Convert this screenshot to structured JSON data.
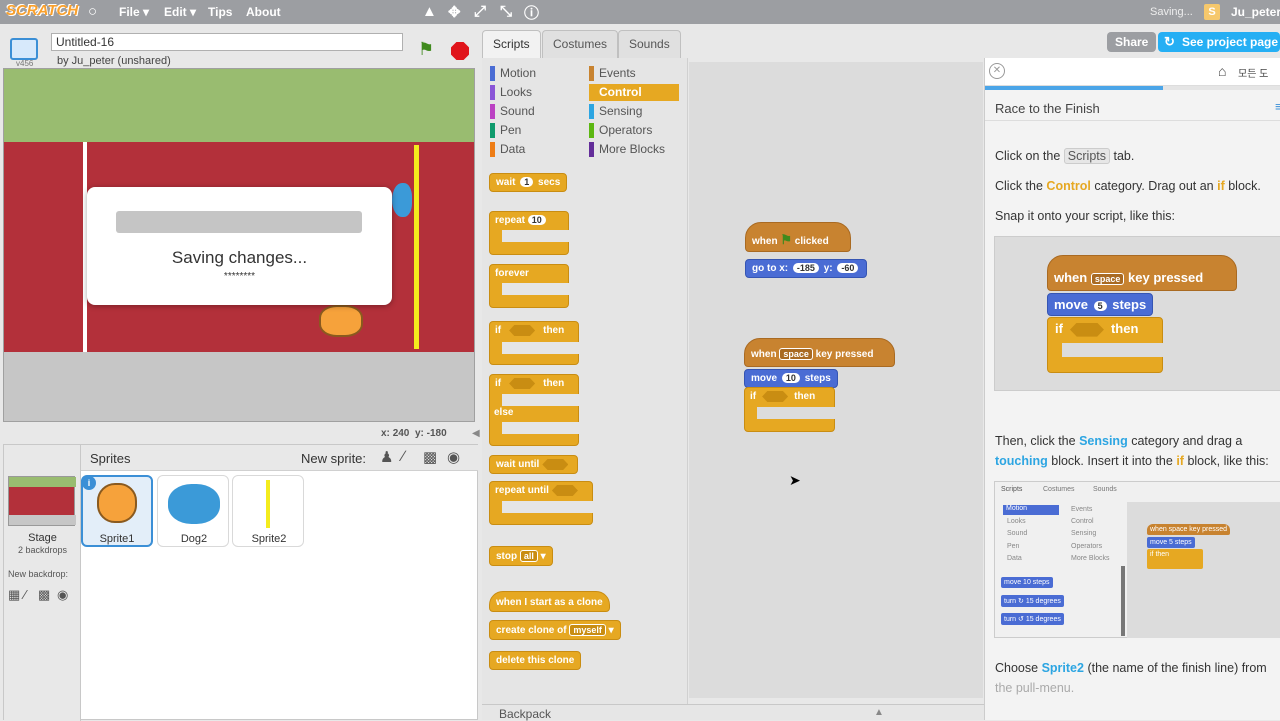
{
  "menubar": {
    "logo": "SCRATCH",
    "file": "File ▾",
    "edit": "Edit ▾",
    "tips": "Tips",
    "about": "About",
    "status": "Saving...",
    "username": "Ju_peter"
  },
  "project": {
    "title": "Untitled-16",
    "byline": "by Ju_peter (unshared)",
    "version": "v456"
  },
  "stage": {
    "dialog_text": "Saving changes...",
    "dialog_sub": "********",
    "x_label": "x:",
    "x_value": "240",
    "y_label": "y:",
    "y_value": "-180"
  },
  "sprites_pane": {
    "title": "Sprites",
    "new_sprite": "New sprite:",
    "stage_label": "Stage",
    "stage_backdrops": "2 backdrops",
    "new_backdrop": "New backdrop:",
    "sprites": [
      "Sprite1",
      "Dog2",
      "Sprite2"
    ]
  },
  "tabs": [
    "Scripts",
    "Costumes",
    "Sounds"
  ],
  "categories": {
    "left": [
      {
        "label": "Motion",
        "color": "#4a6cd4"
      },
      {
        "label": "Looks",
        "color": "#8a55d7"
      },
      {
        "label": "Sound",
        "color": "#bb42c3"
      },
      {
        "label": "Pen",
        "color": "#0e9a6c"
      },
      {
        "label": "Data",
        "color": "#ee7d16"
      }
    ],
    "right": [
      {
        "label": "Events",
        "color": "#c88330"
      },
      {
        "label": "Control",
        "color": "#e6a822"
      },
      {
        "label": "Sensing",
        "color": "#2ca5e2"
      },
      {
        "label": "Operators",
        "color": "#5cb712"
      },
      {
        "label": "More Blocks",
        "color": "#632d99"
      }
    ]
  },
  "palette_blocks": {
    "wait": "wait",
    "wait_val": "1",
    "wait_unit": "secs",
    "repeat": "repeat",
    "repeat_val": "10",
    "forever": "forever",
    "if": "if",
    "then": "then",
    "else": "else",
    "wait_until": "wait until",
    "repeat_until": "repeat until",
    "stop": "stop",
    "stop_val": "all",
    "clone_start": "when I start as a clone",
    "create_clone": "create clone of",
    "create_clone_val": "myself",
    "delete_clone": "delete this clone"
  },
  "script1": {
    "when": "when",
    "clicked": "clicked",
    "goto": "go to x:",
    "x": "-185",
    "y_label": "y:",
    "y": "-60"
  },
  "script2": {
    "when": "when",
    "key": "space",
    "pressed": "key pressed",
    "move": "move",
    "steps_val": "10",
    "steps": "steps",
    "if": "if",
    "then": "then"
  },
  "backpack": "Backpack",
  "header_right": {
    "share": "Share",
    "see_project": "See project page"
  },
  "tips_panel": {
    "home": "모든 도",
    "title": "Race to the Finish",
    "progress": 0.6,
    "step1_a": "Click on the",
    "step1_k": "Scripts",
    "step1_b": "tab.",
    "step2_a": "Click the",
    "step2_c": "Control",
    "step2_b": "category. Drag out an",
    "step2_if": "if",
    "step2_d": "block.",
    "step3": "Snap it onto your script, like this:",
    "ex1_when": "when",
    "ex1_key": "space",
    "ex1_pressed": "key pressed",
    "ex1_move": "move",
    "ex1_steps_val": "5",
    "ex1_steps": "steps",
    "ex1_if": "if",
    "ex1_then": "then",
    "step4_a": "Then, click the",
    "step4_s": "Sensing",
    "step4_b": "category and drag a",
    "step4_t": "touching",
    "step4_c": "block. Insert it into the",
    "step4_if": "if",
    "step4_d": "block, like this:",
    "ex2_tabs": [
      "Scripts",
      "Costumes",
      "Sounds"
    ],
    "ex2_cats_left": [
      "Motion",
      "Looks",
      "Sound",
      "Pen",
      "Data"
    ],
    "ex2_cats_right": [
      "Events",
      "Control",
      "Sensing",
      "Operators",
      "More Blocks"
    ],
    "ex2_move": "move 10 steps",
    "ex2_turn1": "turn ↻ 15 degrees",
    "ex2_turn2": "turn ↺ 15 degrees",
    "ex2_script": [
      "when space key pressed",
      "move 5 steps",
      "if then"
    ],
    "step5_a": "Choose",
    "step5_s": "Sprite2",
    "step5_b": "(the name of the finish line) from",
    "step5_c": "the pull-menu."
  }
}
